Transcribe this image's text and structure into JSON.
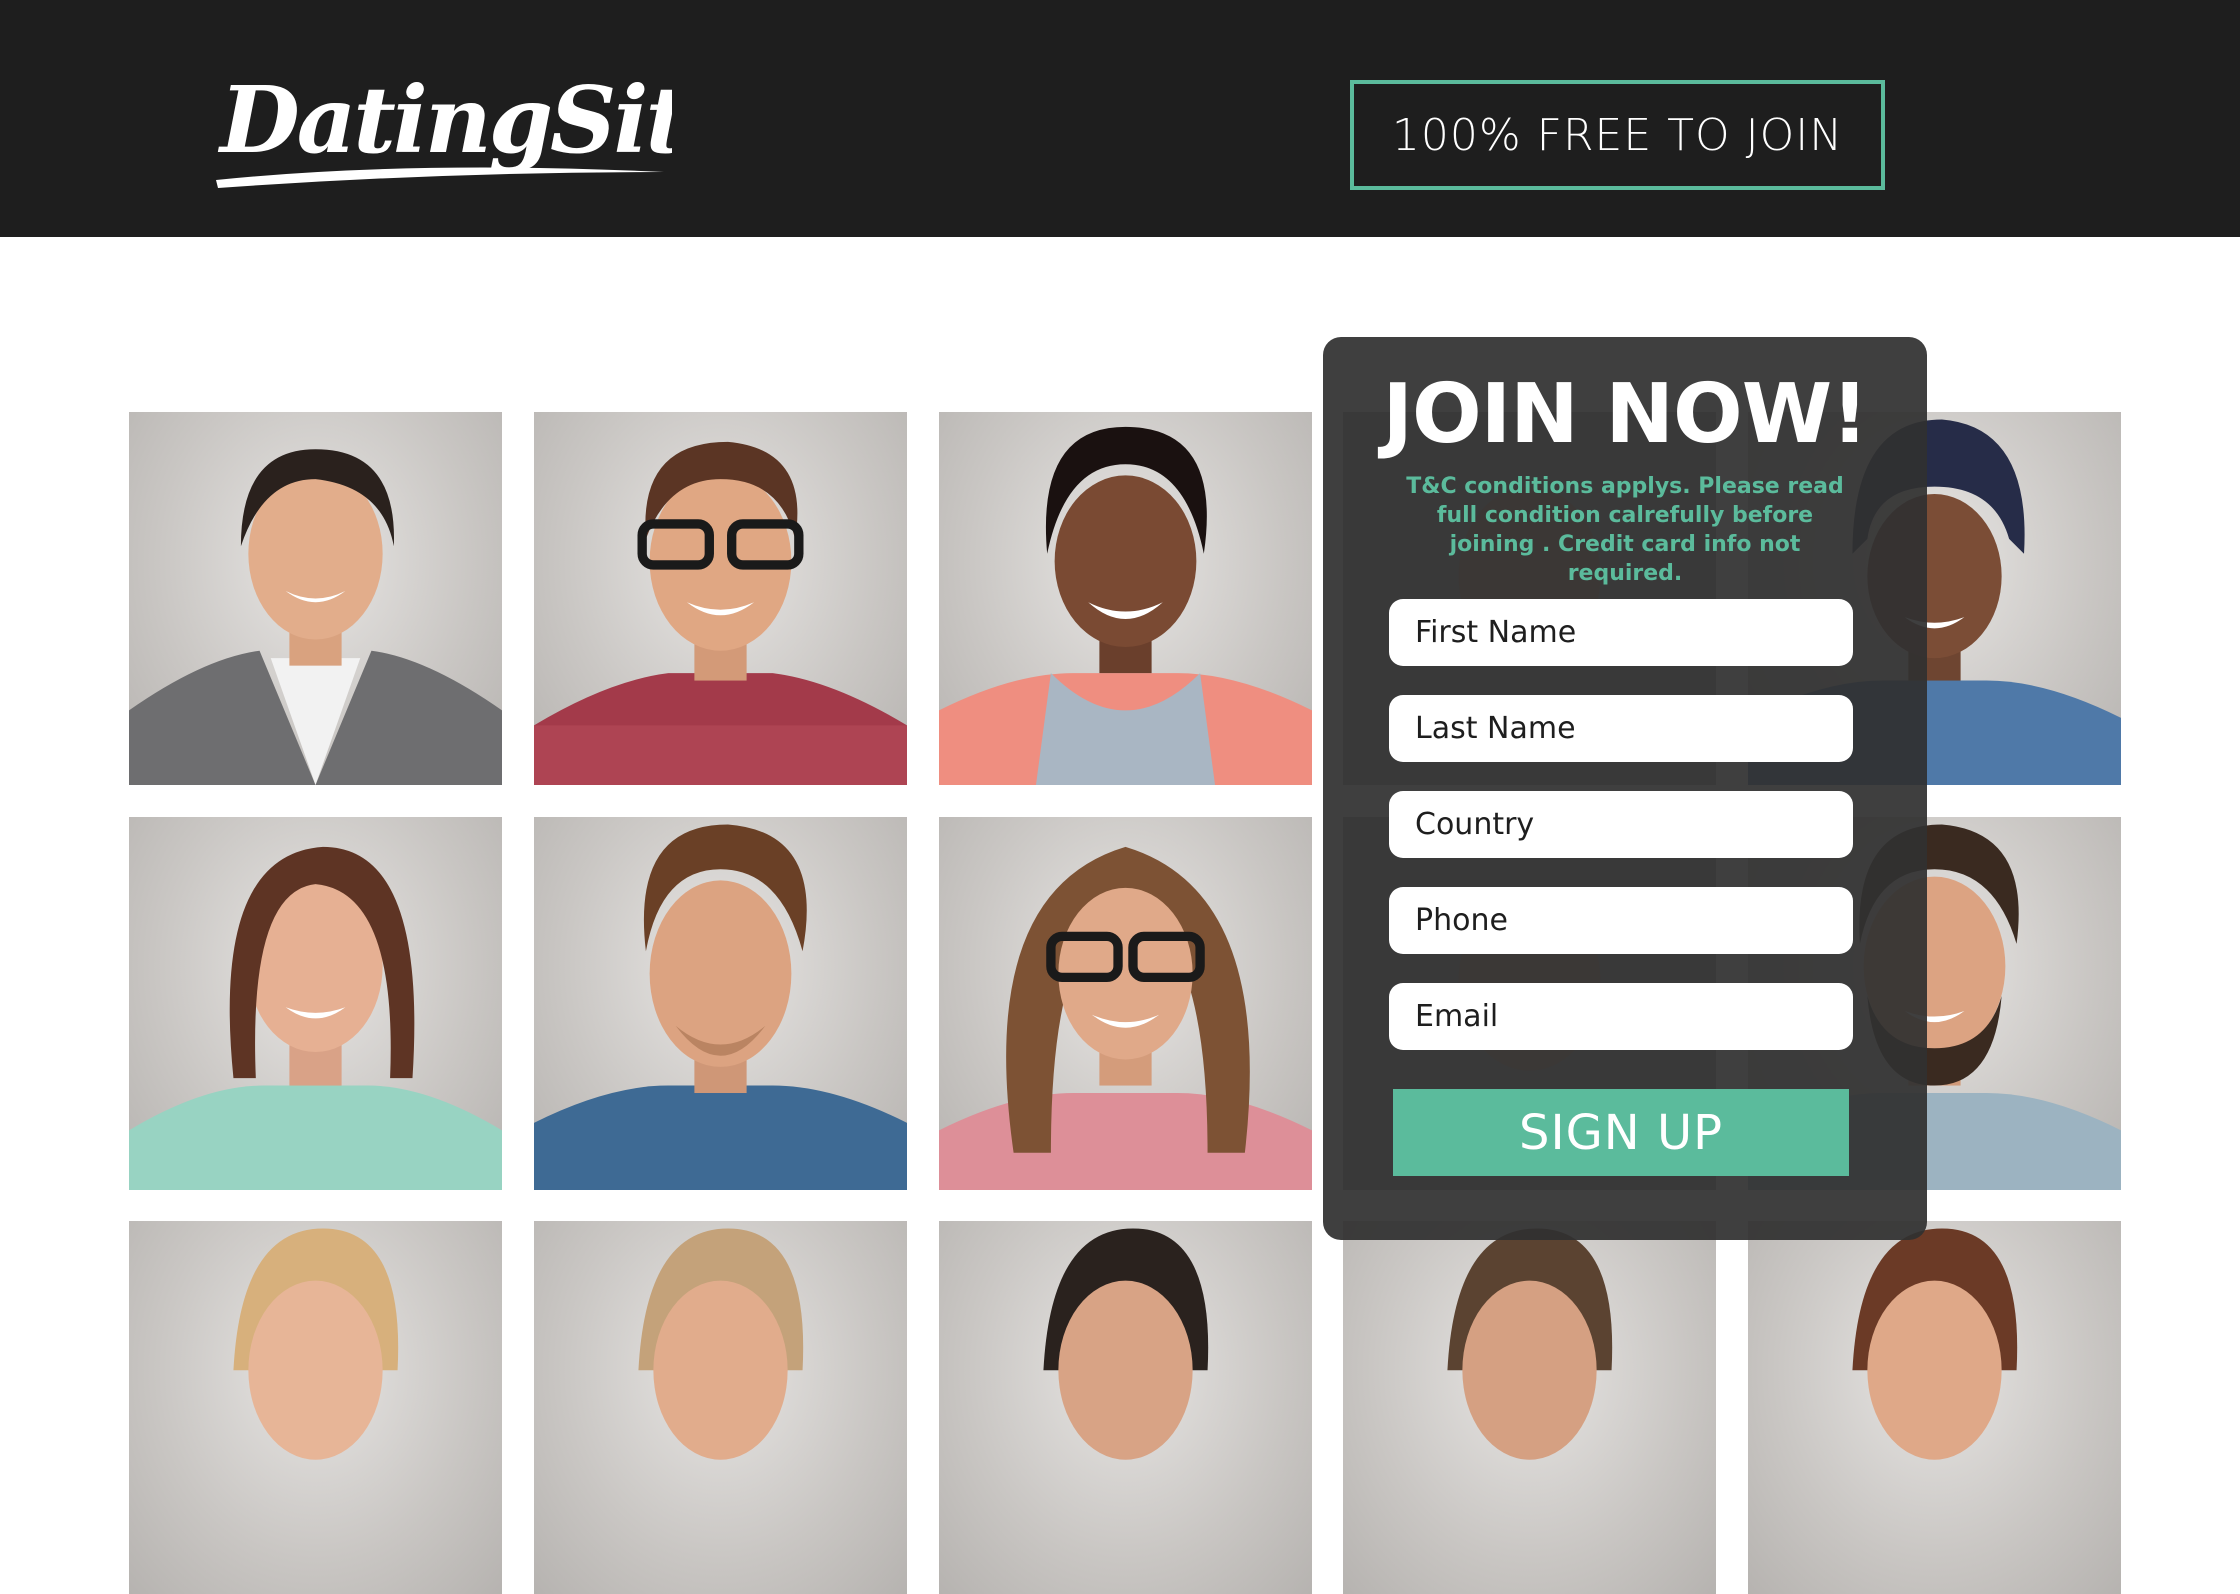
{
  "header": {
    "logo_text": "DatingSite",
    "free_button_label": "100% FREE TO JOIN"
  },
  "colors": {
    "header_bg": "#1e1e1e",
    "accent": "#5bbb9c",
    "panel_bg": "#303030"
  },
  "profiles": {
    "row1": [
      "woman-1",
      "man-glasses",
      "woman-2",
      "man-4",
      "man-beanie"
    ],
    "row2": [
      "woman-3",
      "man-denim",
      "man-long-hair",
      "man-5",
      "man-beard"
    ],
    "row3": [
      "person-11",
      "person-12",
      "person-13",
      "person-14",
      "person-15"
    ]
  },
  "signup": {
    "title": "JOIN NOW!",
    "terms": "T&C conditions applys. Please read full condition calrefully before joining . Credit card info not required.",
    "fields": {
      "first_name": "First Name",
      "last_name": "Last Name",
      "country": "Country",
      "phone": "Phone",
      "email": "Email"
    },
    "button_label": "SIGN UP"
  }
}
